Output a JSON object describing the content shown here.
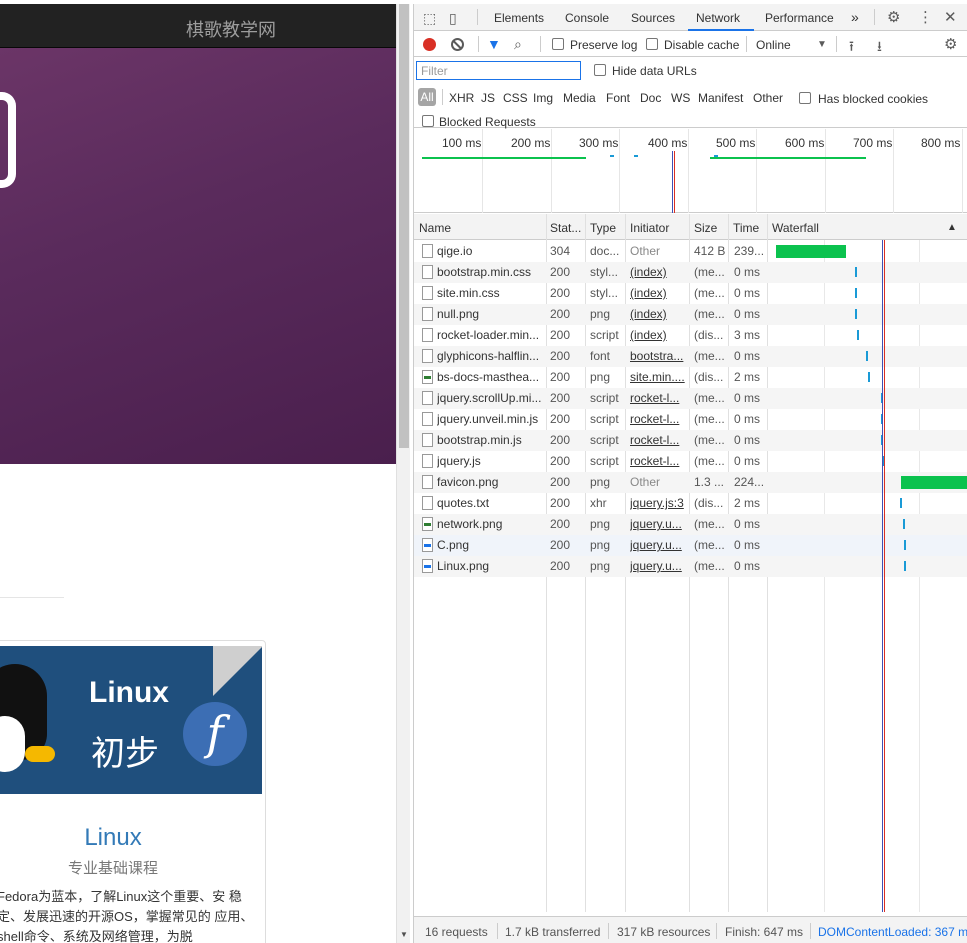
{
  "page": {
    "brand": "棋歌教学网",
    "card": {
      "image_line1": "Linux",
      "image_line2": "初步",
      "image_logo": "f",
      "title": "Linux",
      "subtitle": "专业基础课程",
      "description": "Fedora为蓝本，了解Linux这个重要、安 稳定、发展迅速的开源OS，掌握常见的 应用、shell命令、系统及网络管理，为脱"
    }
  },
  "devtools": {
    "tabs": [
      "Elements",
      "Console",
      "Sources",
      "Network",
      "Performance"
    ],
    "active_tab": "Network",
    "more_tabs": "»",
    "toolbar": {
      "preserve_log": "Preserve log",
      "disable_cache": "Disable cache",
      "throttle": "Online"
    },
    "filter": {
      "placeholder": "Filter",
      "hide_data_urls": "Hide data URLs",
      "types": [
        "All",
        "XHR",
        "JS",
        "CSS",
        "Img",
        "Media",
        "Font",
        "Doc",
        "WS",
        "Manifest",
        "Other"
      ],
      "has_blocked_cookies": "Has blocked cookies",
      "blocked_requests": "Blocked Requests"
    },
    "overview_ticks": [
      "100 ms",
      "200 ms",
      "300 ms",
      "400 ms",
      "500 ms",
      "600 ms",
      "700 ms",
      "800 ms"
    ],
    "columns": [
      "Name",
      "Stat...",
      "Type",
      "Initiator",
      "Size",
      "Time",
      "Waterfall"
    ],
    "requests": [
      {
        "name": "qige.io",
        "status": "304",
        "type": "doc...",
        "initiator": "Other",
        "size": "412 B",
        "time": "239...",
        "icon": "doc"
      },
      {
        "name": "bootstrap.min.css",
        "status": "200",
        "type": "styl...",
        "initiator": "(index)",
        "size": "(me...",
        "time": "0 ms",
        "icon": "doc"
      },
      {
        "name": "site.min.css",
        "status": "200",
        "type": "styl...",
        "initiator": "(index)",
        "size": "(me...",
        "time": "0 ms",
        "icon": "doc"
      },
      {
        "name": "null.png",
        "status": "200",
        "type": "png",
        "initiator": "(index)",
        "size": "(me...",
        "time": "0 ms",
        "icon": "doc"
      },
      {
        "name": "rocket-loader.min...",
        "status": "200",
        "type": "script",
        "initiator": "(index)",
        "size": "(dis...",
        "time": "3 ms",
        "icon": "doc"
      },
      {
        "name": "glyphicons-halflin...",
        "status": "200",
        "type": "font",
        "initiator": "bootstra...",
        "size": "(me...",
        "time": "0 ms",
        "icon": "doc"
      },
      {
        "name": "bs-docs-masthea...",
        "status": "200",
        "type": "png",
        "initiator": "site.min....",
        "size": "(dis...",
        "time": "2 ms",
        "icon": "img"
      },
      {
        "name": "jquery.scrollUp.mi...",
        "status": "200",
        "type": "script",
        "initiator": "rocket-l...",
        "size": "(me...",
        "time": "0 ms",
        "icon": "doc"
      },
      {
        "name": "jquery.unveil.min.js",
        "status": "200",
        "type": "script",
        "initiator": "rocket-l...",
        "size": "(me...",
        "time": "0 ms",
        "icon": "doc"
      },
      {
        "name": "bootstrap.min.js",
        "status": "200",
        "type": "script",
        "initiator": "rocket-l...",
        "size": "(me...",
        "time": "0 ms",
        "icon": "doc"
      },
      {
        "name": "jquery.js",
        "status": "200",
        "type": "script",
        "initiator": "rocket-l...",
        "size": "(me...",
        "time": "0 ms",
        "icon": "doc"
      },
      {
        "name": "favicon.png",
        "status": "200",
        "type": "png",
        "initiator": "Other",
        "size": "1.3 ...",
        "time": "224...",
        "icon": "doc"
      },
      {
        "name": "quotes.txt",
        "status": "200",
        "type": "xhr",
        "initiator": "jquery.js:3",
        "size": "(dis...",
        "time": "2 ms",
        "icon": "doc"
      },
      {
        "name": "network.png",
        "status": "200",
        "type": "png",
        "initiator": "jquery.u...",
        "size": "(me...",
        "time": "0 ms",
        "icon": "img"
      },
      {
        "name": "C.png",
        "status": "200",
        "type": "png",
        "initiator": "jquery.u...",
        "size": "(me...",
        "time": "0 ms",
        "icon": "img2"
      },
      {
        "name": "Linux.png",
        "status": "200",
        "type": "png",
        "initiator": "jquery.u...",
        "size": "(me...",
        "time": "0 ms",
        "icon": "img2"
      }
    ],
    "status": {
      "requests": "16 requests",
      "transferred": "1.7 kB transferred",
      "resources": "317 kB resources",
      "finish": "Finish: 647 ms",
      "dom_loaded": "DOMContentLoaded: 367 ms"
    },
    "colors": {
      "record": "#d93025",
      "accent": "#1a73e8",
      "waterfall_green": "#0bc24e",
      "waterfall_blue": "#1a9ad6"
    }
  }
}
